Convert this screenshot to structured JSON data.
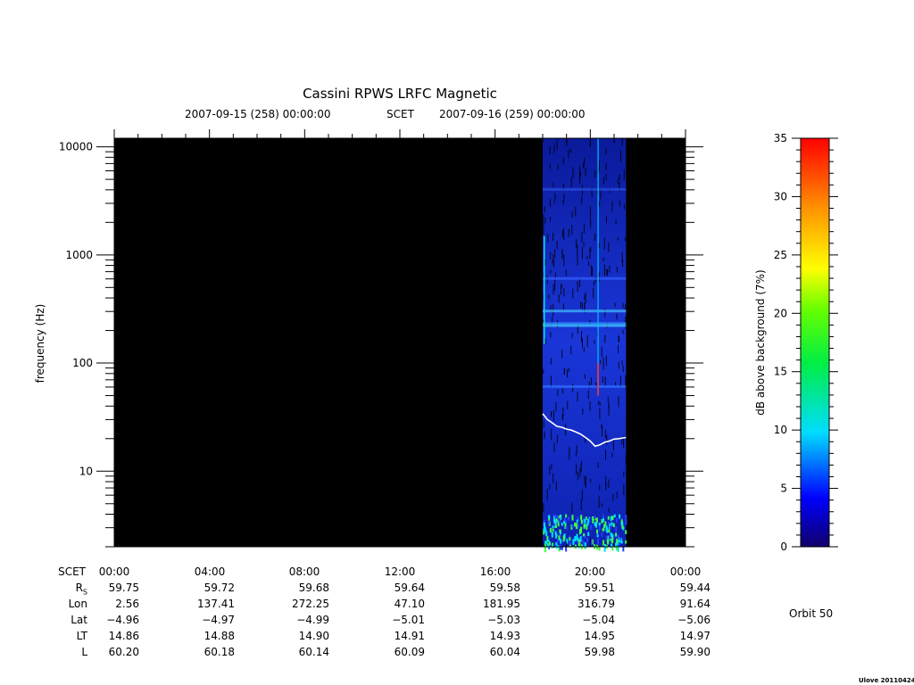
{
  "chart_data": {
    "type": "heatmap",
    "title": "Cassini RPWS LRFC Magnetic",
    "time_start": "2007-09-15 (258) 00:00:00",
    "scet_label": "SCET",
    "time_end": "2007-09-16 (259) 00:00:00",
    "ylabel": "frequency (Hz)",
    "yscale": "log",
    "ylim": [
      2,
      12000
    ],
    "yticks": [
      {
        "value": 10,
        "label": "10"
      },
      {
        "value": 100,
        "label": "100"
      },
      {
        "value": 1000,
        "label": "1000"
      },
      {
        "value": 10000,
        "label": "10000"
      }
    ],
    "xlim_hours": [
      0,
      24
    ],
    "xtick_labels": [
      "00:00",
      "04:00",
      "08:00",
      "12:00",
      "16:00",
      "20:00",
      "00:00"
    ],
    "data_coverage_hours": [
      18.0,
      21.5
    ],
    "white_line": {
      "name": "",
      "hours": [
        18.0,
        18.2,
        18.4,
        18.6,
        18.8,
        19.0,
        19.2,
        19.4,
        19.6,
        19.8,
        20.0,
        20.2,
        20.4,
        20.6,
        20.8,
        21.0,
        21.2,
        21.5
      ],
      "freq_hz": [
        34,
        30,
        28,
        26,
        25.5,
        24.5,
        24,
        23,
        22,
        20.5,
        19,
        17,
        17.5,
        18.5,
        19,
        19.8,
        20,
        20.5
      ]
    },
    "colorbar": {
      "label": "dB above background (7%)",
      "range": [
        0,
        35
      ],
      "ticks": [
        "0",
        "5",
        "10",
        "15",
        "20",
        "25",
        "30",
        "35"
      ]
    }
  },
  "ephemeris": {
    "rows": [
      {
        "label": "SCET",
        "values": [
          "00:00",
          "04:00",
          "08:00",
          "12:00",
          "16:00",
          "20:00",
          "00:00"
        ]
      },
      {
        "label": "R",
        "sub": "S",
        "values": [
          "59.75",
          "59.72",
          "59.68",
          "59.64",
          "59.58",
          "59.51",
          "59.44"
        ]
      },
      {
        "label": "Lon",
        "values": [
          "2.56",
          "137.41",
          "272.25",
          "47.10",
          "181.95",
          "316.79",
          "91.64"
        ]
      },
      {
        "label": "Lat",
        "values": [
          "−4.96",
          "−4.97",
          "−4.99",
          "−5.01",
          "−5.03",
          "−5.04",
          "−5.06"
        ]
      },
      {
        "label": "LT",
        "values": [
          "14.86",
          "14.88",
          "14.90",
          "14.91",
          "14.93",
          "14.95",
          "14.97"
        ]
      },
      {
        "label": "L",
        "values": [
          "60.20",
          "60.18",
          "60.14",
          "60.09",
          "60.04",
          "59.98",
          "59.90"
        ]
      }
    ]
  },
  "orbit_label": "Orbit 50",
  "stamp": "Ulove 20110424"
}
